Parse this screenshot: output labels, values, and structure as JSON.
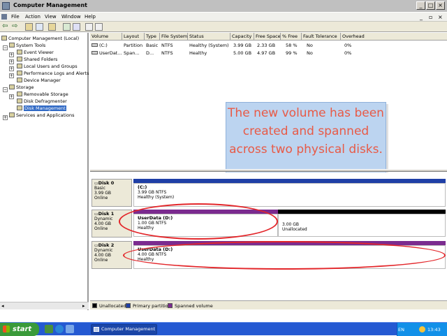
{
  "window": {
    "title": "Computer Management"
  },
  "menu": [
    "File",
    "Action",
    "View",
    "Window",
    "Help"
  ],
  "tree": [
    {
      "label": "Computer Management (Local)",
      "level": 0
    },
    {
      "label": "System Tools",
      "level": 1
    },
    {
      "label": "Event Viewer",
      "level": 2
    },
    {
      "label": "Shared Folders",
      "level": 2
    },
    {
      "label": "Local Users and Groups",
      "level": 2
    },
    {
      "label": "Performance Logs and Alerts",
      "level": 2
    },
    {
      "label": "Device Manager",
      "level": 2
    },
    {
      "label": "Storage",
      "level": 1
    },
    {
      "label": "Removable Storage",
      "level": 2
    },
    {
      "label": "Disk Defragmenter",
      "level": 2
    },
    {
      "label": "Disk Management",
      "level": 2,
      "selected": true
    },
    {
      "label": "Services and Applications",
      "level": 1
    }
  ],
  "volume_table": {
    "columns": [
      "Volume",
      "Layout",
      "Type",
      "File System",
      "Status",
      "Capacity",
      "Free Space",
      "% Free",
      "Fault Tolerance",
      "Overhead"
    ],
    "rows": [
      [
        "(C:)",
        "Partition",
        "Basic",
        "NTFS",
        "Healthy (System)",
        "3.99 GB",
        "2.33 GB",
        "58 %",
        "No",
        "0%"
      ],
      [
        "UserDat...",
        "Span...",
        "D...",
        "NTFS",
        "Healthy",
        "5.00 GB",
        "4.97 GB",
        "99 %",
        "No",
        "0%"
      ]
    ]
  },
  "callout": {
    "text": "The new volume has been created and spanned across two physical disks."
  },
  "disks": [
    {
      "name": "Disk 0",
      "type": "Basic",
      "size": "3.99 GB",
      "status": "Online",
      "partitions": [
        {
          "name": "(C:)",
          "detail": "3.99 GB NTFS",
          "status": "Healthy (System)"
        }
      ]
    },
    {
      "name": "Disk 1",
      "type": "Dynamic",
      "size": "4.00 GB",
      "status": "Online",
      "partitions": [
        {
          "name": "UserData  (D:)",
          "detail": "1.00 GB NTFS",
          "status": "Healthy"
        },
        {
          "name": "",
          "detail": "3.00 GB",
          "status": "Unallocated"
        }
      ]
    },
    {
      "name": "Disk 2",
      "type": "Dynamic",
      "size": "4.00 GB",
      "status": "Online",
      "partitions": [
        {
          "name": "UserData  (D:)",
          "detail": "4.00 GB NTFS",
          "status": "Healthy"
        }
      ]
    }
  ],
  "legend": [
    {
      "label": "Unallocated",
      "color": "#000000"
    },
    {
      "label": "Primary partition",
      "color": "#1f3fa6"
    },
    {
      "label": "Spanned volume",
      "color": "#7b2b8f"
    }
  ],
  "colors": {
    "primary": "#1f3fa6",
    "spanned": "#7b2b8f",
    "unallocated": "#000000",
    "callout_text": "#e85a46",
    "callout_bg": "#bcd4f0",
    "highlight": "#e3262a"
  },
  "taskbar": {
    "start": "start",
    "task": "Computer Management",
    "lang": "EN",
    "clock": "13:43"
  }
}
